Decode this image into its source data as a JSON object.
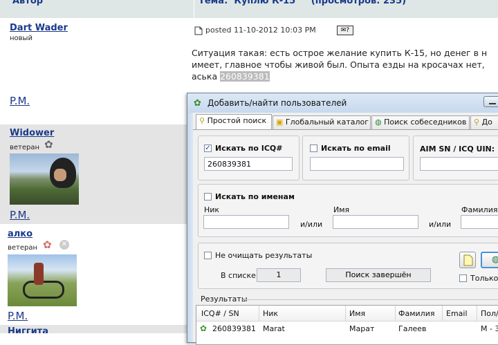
{
  "forum": {
    "header_left": "Автор",
    "header_right": "Тема:  Куплю К-15     (просмотров: 235)",
    "posts": [
      {
        "author": "Dart Wader",
        "rank": "новый",
        "pm": "P.M.",
        "posted": "posted 11-10-2012 10:03 PM",
        "text1": "Ситуация такая: есть острое желание купить К-15, но денег в н",
        "text2": "имеет, главное чтобы живой был. Опыта езды на кросачах нет,",
        "text3": "аська",
        "icq": "260839381"
      },
      {
        "author": "Widower",
        "rank": "ветеран",
        "pm": "P.M."
      },
      {
        "author": "алко",
        "rank": "ветеран",
        "pm": "P.M."
      },
      {
        "author": "Ниггита"
      }
    ]
  },
  "window": {
    "title": "Добавить/найти пользователей",
    "tabs": [
      "Простой поиск",
      "Глобальный каталог",
      "Поиск собеседников",
      "До"
    ],
    "icq_group": {
      "label": "Искать по ICQ#",
      "checked": true,
      "value": "260839381"
    },
    "email_group": {
      "label": "Искать по email",
      "checked": false,
      "value": ""
    },
    "aim_group": {
      "label": "AIM SN / ICQ UIN:",
      "value": ""
    },
    "names_group": {
      "label": "Искать по именам",
      "checked": false,
      "nick_label": "Ник",
      "name_label": "Имя",
      "surname_label": "Фамилия",
      "andor": "и/или"
    },
    "options": {
      "no_clear_label": "Не очищать результаты",
      "in_list_label": "В списке:",
      "in_list_value": "1",
      "status": "Поиск завершён",
      "only_label": "Только"
    },
    "results": {
      "label": "Результаты",
      "columns": [
        "ICQ# / SN",
        "Ник",
        "Имя",
        "Фамилия",
        "Email",
        "Пол/"
      ],
      "rows": [
        {
          "icq": "260839381",
          "nick": "Marat",
          "name": "Марат",
          "surname": "Галеев",
          "email": "",
          "sex": "М - 3"
        }
      ]
    }
  }
}
